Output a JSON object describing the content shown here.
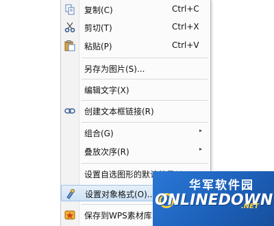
{
  "menu": {
    "copy": {
      "label": "复制(C)",
      "shortcut": "Ctrl+C",
      "icon": "copy-icon"
    },
    "cut": {
      "label": "剪切(T)",
      "shortcut": "Ctrl+X",
      "icon": "scissors-icon"
    },
    "paste": {
      "label": "粘贴(P)",
      "shortcut": "Ctrl+V",
      "icon": "paste-icon"
    },
    "save_as_image": {
      "label": "另存为图片(S)..."
    },
    "edit_text": {
      "label": "编辑文字(X)"
    },
    "create_link": {
      "label": "创建文本框链接(R)",
      "icon": "link-icon"
    },
    "group": {
      "label": "组合(G)",
      "submenu": "▸"
    },
    "order": {
      "label": "叠放次序(R)",
      "submenu": "▸"
    },
    "default_autoshape": {
      "label": "设置自选图形的默认效果(I)"
    },
    "format_object": {
      "label": "设置对象格式(O)...",
      "icon": "format-brush-icon"
    },
    "save_to_wps": {
      "label": "保存到WPS素材库",
      "icon": "wps-library-icon"
    }
  },
  "watermark": {
    "title": "华军软件园",
    "brand": "ONLINEDOWN",
    "tld": ".NET"
  },
  "colors": {
    "highlight": "#cde2f6",
    "watermark_blue": "#1c5fb8",
    "watermark_yellow": "#ffd23f"
  }
}
